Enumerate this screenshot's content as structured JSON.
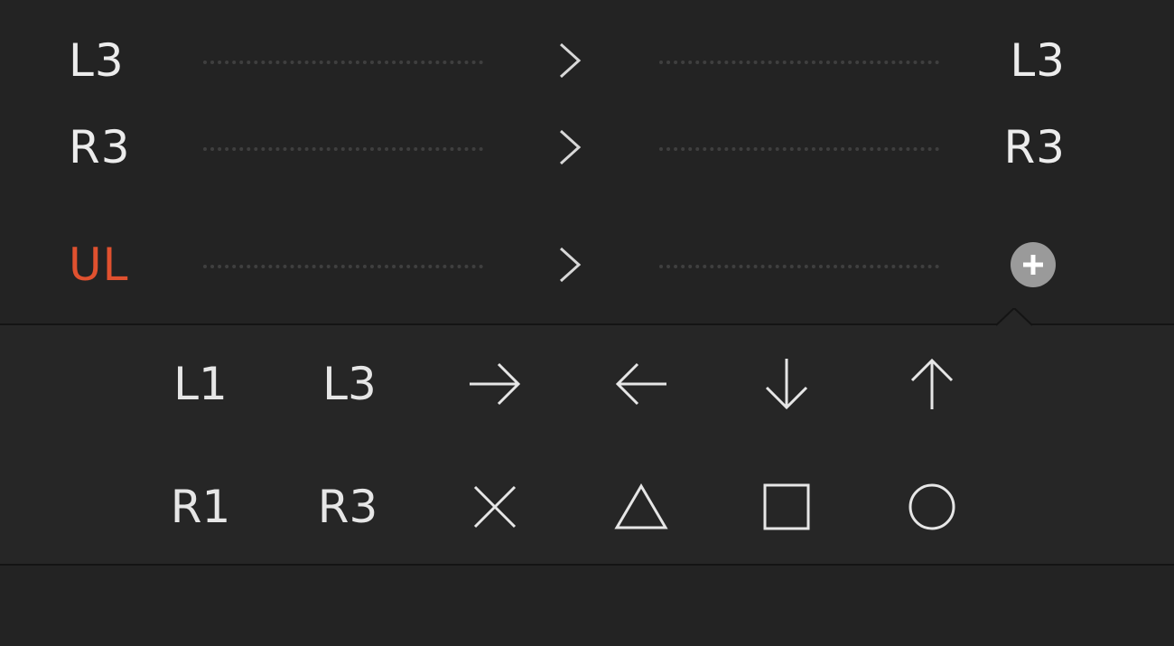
{
  "mappings": [
    {
      "source": "L3",
      "target": "L3",
      "source_color": "#ececec"
    },
    {
      "source": "R3",
      "target": "R3",
      "source_color": "#ececec"
    },
    {
      "source": "UL",
      "target": null,
      "source_color": "#e0512f",
      "target_action": "add"
    }
  ],
  "picker": {
    "row1": [
      {
        "label": "L1"
      },
      {
        "label": "L3"
      },
      {
        "icon": "arrow-right-icon"
      },
      {
        "icon": "arrow-left-icon"
      },
      {
        "icon": "arrow-down-icon"
      },
      {
        "icon": "arrow-up-icon"
      }
    ],
    "row2": [
      {
        "label": "R1"
      },
      {
        "label": "R3"
      },
      {
        "icon": "cross-icon"
      },
      {
        "icon": "triangle-icon"
      },
      {
        "icon": "square-icon"
      },
      {
        "icon": "circle-icon"
      }
    ]
  },
  "colors": {
    "background": "#232323",
    "accent_red": "#e0512f",
    "add_button": "#9a9a9a",
    "divider": "#141414"
  }
}
